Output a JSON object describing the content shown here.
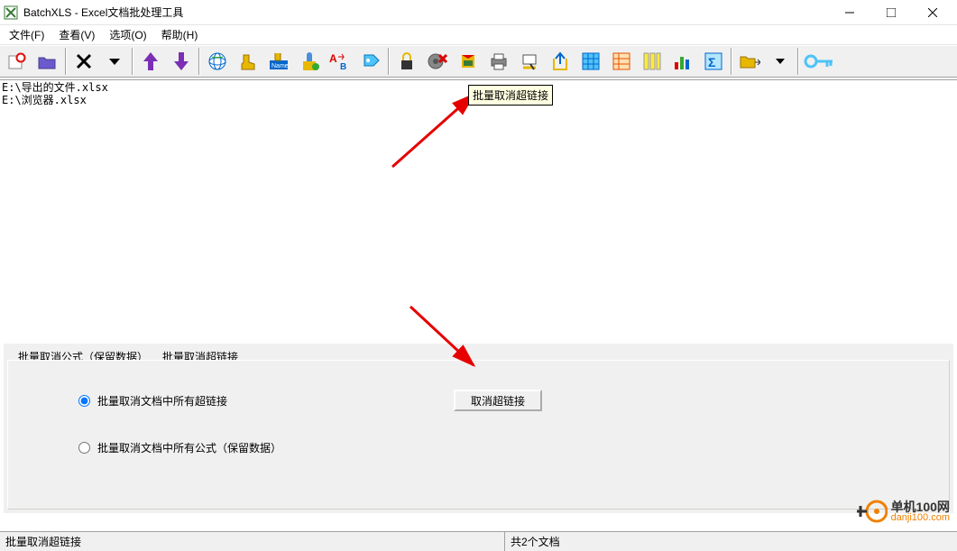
{
  "window": {
    "title": "BatchXLS - Excel文档批处理工具"
  },
  "menu": {
    "file": "文件(F)",
    "view": "查看(V)",
    "options": "选项(O)",
    "help": "帮助(H)"
  },
  "tooltip": {
    "text": "批量取消超链接"
  },
  "files": {
    "f0": "E:\\导出的文件.xlsx",
    "f1": "E:\\浏览器.xlsx"
  },
  "panel": {
    "tab0": "批量取消公式（保留数据）",
    "tab1": "批量取消超链接",
    "radio0": "批量取消文档中所有超链接",
    "radio1": "批量取消文档中所有公式（保留数据）",
    "action": "取消超链接"
  },
  "status": {
    "left": "批量取消超链接",
    "right": "共2个文档"
  },
  "watermark": {
    "line1": "单机100网",
    "line2": "danji100.com"
  }
}
